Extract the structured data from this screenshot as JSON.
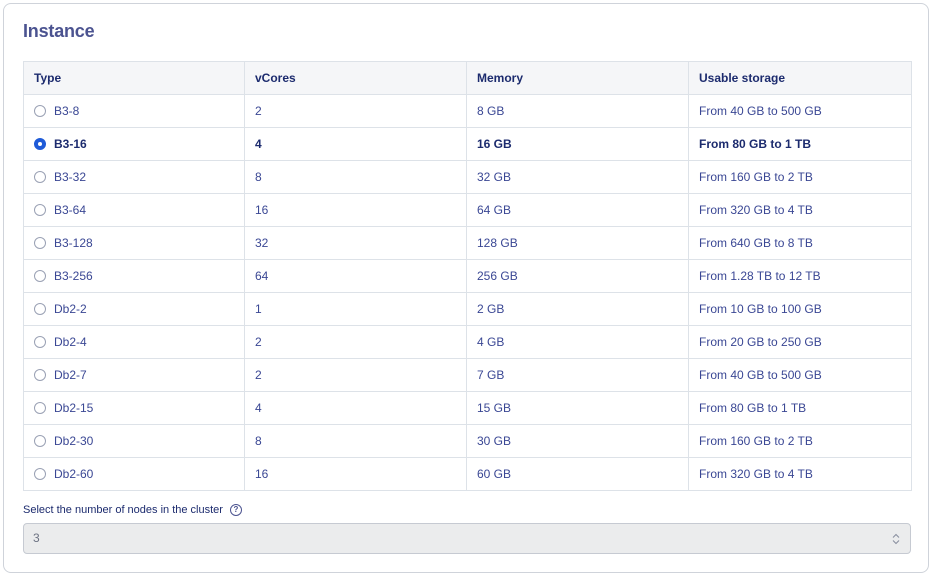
{
  "section": {
    "title": "Instance"
  },
  "table": {
    "headers": {
      "type": "Type",
      "vcores": "vCores",
      "memory": "Memory",
      "storage": "Usable storage"
    },
    "rows": [
      {
        "type": "B3-8",
        "vcores": "2",
        "memory": "8 GB",
        "storage": "From 40 GB to 500 GB",
        "selected": false
      },
      {
        "type": "B3-16",
        "vcores": "4",
        "memory": "16 GB",
        "storage": "From 80 GB to 1 TB",
        "selected": true
      },
      {
        "type": "B3-32",
        "vcores": "8",
        "memory": "32 GB",
        "storage": "From 160 GB to 2 TB",
        "selected": false
      },
      {
        "type": "B3-64",
        "vcores": "16",
        "memory": "64 GB",
        "storage": "From 320 GB to 4 TB",
        "selected": false
      },
      {
        "type": "B3-128",
        "vcores": "32",
        "memory": "128 GB",
        "storage": "From 640 GB to 8 TB",
        "selected": false
      },
      {
        "type": "B3-256",
        "vcores": "64",
        "memory": "256 GB",
        "storage": "From 1.28 TB to 12 TB",
        "selected": false
      },
      {
        "type": "Db2-2",
        "vcores": "1",
        "memory": "2 GB",
        "storage": "From 10 GB to 100 GB",
        "selected": false
      },
      {
        "type": "Db2-4",
        "vcores": "2",
        "memory": "4 GB",
        "storage": "From 20 GB to 250 GB",
        "selected": false
      },
      {
        "type": "Db2-7",
        "vcores": "2",
        "memory": "7 GB",
        "storage": "From 40 GB to 500 GB",
        "selected": false
      },
      {
        "type": "Db2-15",
        "vcores": "4",
        "memory": "15 GB",
        "storage": "From 80 GB to 1 TB",
        "selected": false
      },
      {
        "type": "Db2-30",
        "vcores": "8",
        "memory": "30 GB",
        "storage": "From 160 GB to 2 TB",
        "selected": false
      },
      {
        "type": "Db2-60",
        "vcores": "16",
        "memory": "60 GB",
        "storage": "From 320 GB to 4 TB",
        "selected": false
      }
    ]
  },
  "nodes": {
    "label": "Select the number of nodes in the cluster",
    "help_icon": "question-circle-icon",
    "value": "3",
    "arrows_icon": "up-down-chevron-icon"
  },
  "colors": {
    "title": "#4b5390",
    "text": "#1c2b6e",
    "accent": "#1f5bd8",
    "header_bg": "#f5f6f8",
    "select_bg": "#ebeced"
  }
}
